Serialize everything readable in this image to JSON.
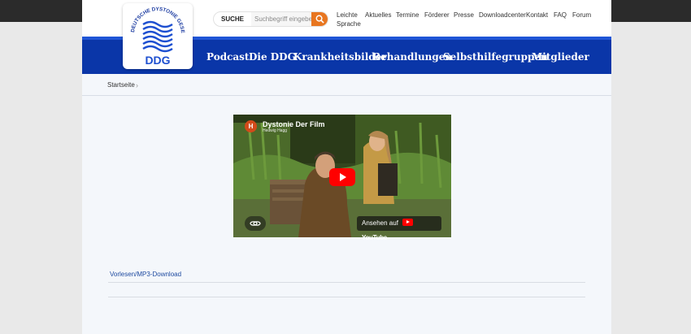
{
  "logo": {
    "org_name": "DEUTSCHE DYSTONIE GESELLSCHAFT e.V.",
    "acronym": "DDG"
  },
  "search": {
    "label": "SUCHE",
    "placeholder": "Suchbegriff eingeben"
  },
  "top_links": [
    "Leichte",
    "Sprache",
    "Aktuelles",
    "Termine",
    "Förderer",
    "Presse",
    "Downloadcenter",
    "Kontakt",
    "FAQ",
    "Forum"
  ],
  "main_nav": [
    "Podcast",
    "Die DDG",
    "Krankheitsbilder",
    "Behandlungen",
    "Selbsthilfegruppen",
    "Mitglieder"
  ],
  "breadcrumb": {
    "home": "Startseite",
    "separator": "›"
  },
  "video": {
    "channel_initial": "H",
    "title": "Dystonie Der Film",
    "author": "Hedwig Hagg",
    "watch_label": "Ansehen auf",
    "platform": "YouTube"
  },
  "content": {
    "mp3_link": "Vorlesen/MP3-Download"
  },
  "colors": {
    "nav_blue": "#0a36a8",
    "accent_orange": "#e87620",
    "youtube_red": "#ff0000"
  }
}
